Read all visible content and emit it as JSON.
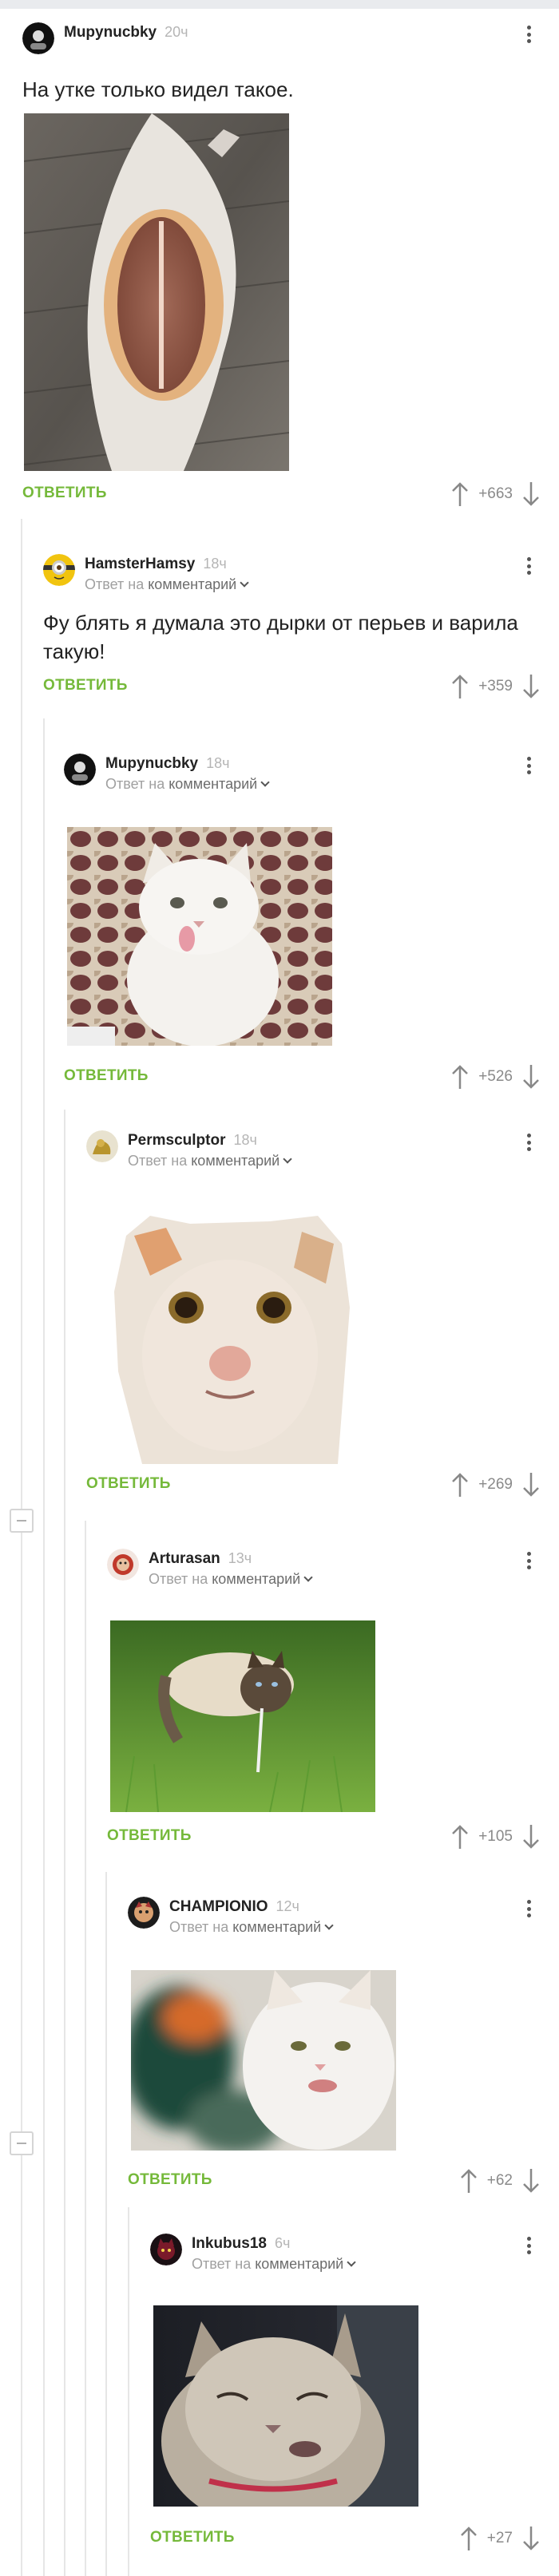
{
  "ui": {
    "reply_label": "ОТВЕТИТЬ",
    "reply_to_prefix": "Ответ на",
    "reply_to_link": "комментарий"
  },
  "comments": [
    {
      "author": "Mupynucbky",
      "time": "20ч",
      "text": "На утке только видел такое.",
      "score": "+663",
      "image": "duck-photo"
    },
    {
      "author": "HamsterHamsy",
      "time": "18ч",
      "text": "Фу блять я думала это дырки от перьев и варила такую!",
      "score": "+359"
    },
    {
      "author": "Mupynucbky",
      "time": "18ч",
      "score": "+526",
      "image": "white-cat-tongue-photo"
    },
    {
      "author": "Permsculptor",
      "time": "18ч",
      "score": "+269",
      "image": "cat-human-face-photo"
    },
    {
      "author": "Arturasan",
      "time": "13ч",
      "score": "+105",
      "image": "siamese-cat-grass-photo"
    },
    {
      "author": "CHAMPIONIO",
      "time": "12ч",
      "score": "+62",
      "image": "white-cat-blur-photo"
    },
    {
      "author": "Inkubus18",
      "time": "6ч",
      "score": "+27",
      "image": "grey-cat-window-photo"
    }
  ],
  "colors": {
    "accent": "#75b93a",
    "meta": "#a0a0a0",
    "thread": "#e6e6e6"
  },
  "icons": [
    "more-vertical-icon",
    "arrow-up-icon",
    "arrow-down-icon",
    "chevron-down-icon",
    "collapse-minus-icon"
  ]
}
